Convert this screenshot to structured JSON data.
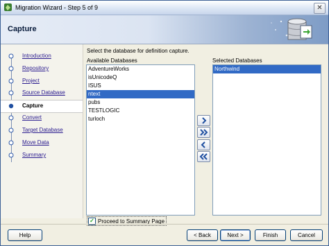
{
  "window": {
    "title": "Migration Wizard - Step 5 of 9"
  },
  "header": {
    "title": "Capture"
  },
  "steps": [
    {
      "label": "Introduction",
      "current": false
    },
    {
      "label": "Repository",
      "current": false
    },
    {
      "label": "Project",
      "current": false
    },
    {
      "label": "Source Database",
      "current": false
    },
    {
      "label": "Capture",
      "current": true
    },
    {
      "label": "Convert",
      "current": false
    },
    {
      "label": "Target Database",
      "current": false
    },
    {
      "label": "Move Data",
      "current": false
    },
    {
      "label": "Summary",
      "current": false
    }
  ],
  "main": {
    "instruction": "Select the database for definition capture.",
    "available_label": "Available Databases",
    "selected_label": "Selected Databases",
    "available": [
      "AdventureWorks",
      "isUnicodeQ",
      "ISUS",
      "ntext",
      "pubs",
      "TESTLOGIC",
      "turloch"
    ],
    "available_selected_index": 3,
    "selected": [
      "Northwind"
    ],
    "selected_selected_index": 0,
    "proceed_label": "Proceed to Summary Page",
    "proceed_checked": true
  },
  "footer": {
    "help": "Help",
    "back": "< Back",
    "next": "Next >",
    "finish": "Finish",
    "cancel": "Cancel"
  },
  "colors": {
    "selection": "#316ac5",
    "accent": "#1f4fa0",
    "link": "#2a1b8f"
  }
}
